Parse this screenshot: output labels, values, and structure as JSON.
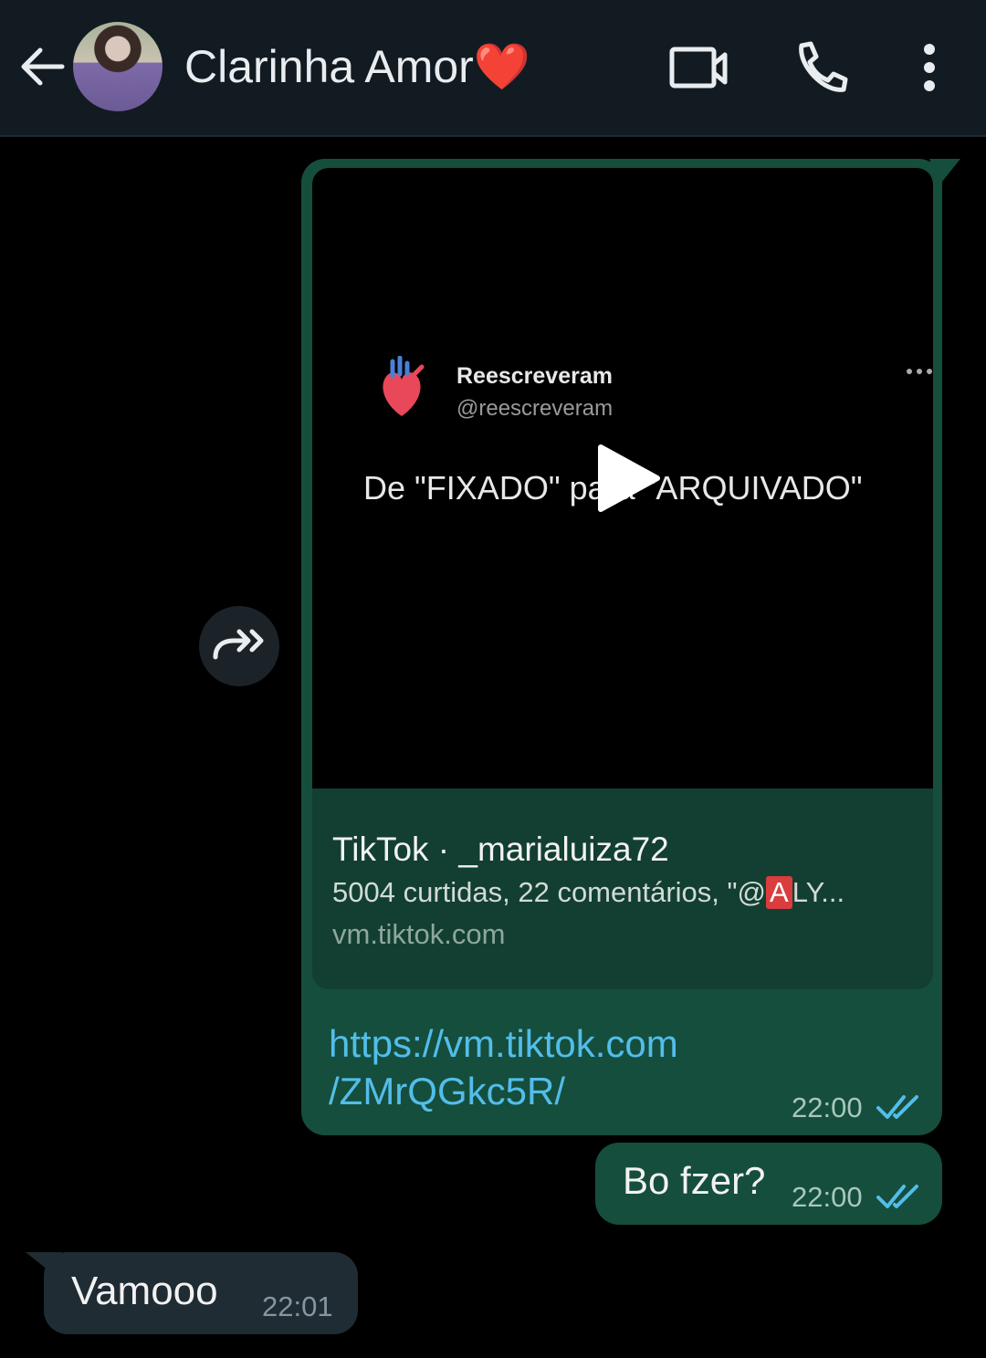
{
  "header": {
    "contact_name": "Clarinha Amor",
    "contact_emoji": "❤️"
  },
  "icons": {
    "back": "arrow-left-icon",
    "video": "video-call-icon",
    "call": "phone-icon",
    "menu": "more-vertical-icon",
    "forward": "forward-icon",
    "play": "play-icon",
    "read_receipt": "double-check-icon"
  },
  "messages": [
    {
      "direction": "outgoing",
      "type": "link",
      "video": {
        "account_name": "Reescreveram",
        "account_handle": "@reescreveram",
        "caption": "De \"FIXADO\" para \"ARQUIVADO\""
      },
      "preview": {
        "title": "TikTok · _marialuiza72",
        "description_prefix": "5004 curtidas, 22 comentários, \"@",
        "description_badge": "A",
        "description_suffix": "LY...",
        "domain": "vm.tiktok.com"
      },
      "url_line1": "https://vm.tiktok.com",
      "url_line2": "/ZMrQGkc5R/",
      "time": "22:00",
      "status": "read"
    },
    {
      "direction": "outgoing",
      "type": "text",
      "text": "Bo fzer?",
      "time": "22:00",
      "status": "read"
    },
    {
      "direction": "incoming",
      "type": "text",
      "text": "Vamooo",
      "time": "22:01"
    }
  ],
  "colors": {
    "header_bg": "#121b22",
    "outgoing_bubble": "#154e3c",
    "incoming_bubble": "#1f2c33",
    "link": "#53bdeb",
    "read_tick": "#53bdeb"
  }
}
